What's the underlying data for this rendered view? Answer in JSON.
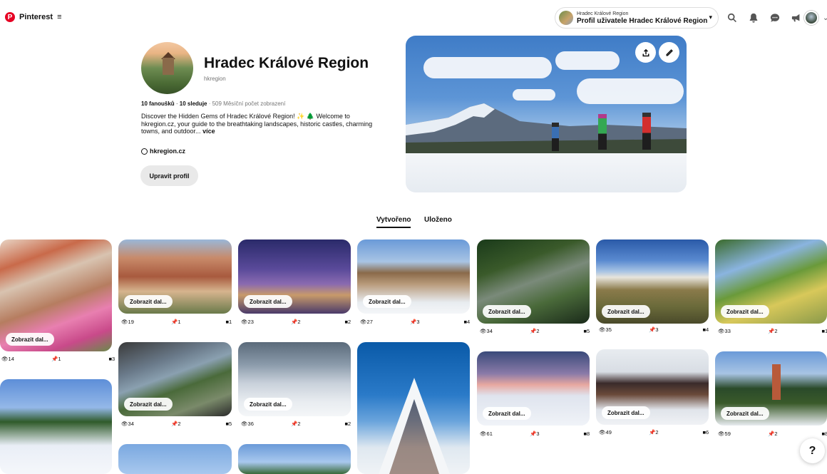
{
  "app": {
    "name": "Pinterest"
  },
  "header": {
    "switch_small": "Hradec Králové Region",
    "switch_main": "Profil uživatele Hradec Králové Region"
  },
  "profile": {
    "name": "Hradec Králové Region",
    "handle": "hkregion",
    "followers": "10 fanoušků",
    "following": "10 sleduje",
    "monthly_views": "509 Měsíční počet zobrazení",
    "bio": "Discover the Hidden Gems of Hradec Králové Region! ✨ 🌲 Welcome to hkregion.cz, your guide to the breathtaking landscapes, historic castles, charming towns, and outdoor...",
    "bio_more": "více",
    "website": "hkregion.cz",
    "edit_button": "Upravit profil"
  },
  "tabs": [
    {
      "label": "Vytvořeno",
      "active": true
    },
    {
      "label": "Uloženo",
      "active": false
    }
  ],
  "pin_button_label": "Zobrazit dal...",
  "pins": [
    {
      "views": "14",
      "pins": "1",
      "saves": "3"
    },
    {
      "views": "19",
      "pins": "1",
      "saves": "1"
    },
    {
      "views": "23",
      "pins": "2",
      "saves": "2"
    },
    {
      "views": "27",
      "pins": "3",
      "saves": "4"
    },
    {
      "views": "34",
      "pins": "2",
      "saves": "5"
    },
    {
      "views": "35",
      "pins": "3",
      "saves": "4"
    },
    {
      "views": "33",
      "pins": "2",
      "saves": "1"
    },
    {
      "views": "34",
      "pins": "2",
      "saves": "5"
    },
    {
      "views": "36",
      "pins": "2",
      "saves": "2"
    },
    {
      "views": "61",
      "pins": "3",
      "saves": "8"
    },
    {
      "views": "49",
      "pins": "2",
      "saves": "6"
    },
    {
      "views": "59",
      "pins": "2",
      "saves": "8"
    }
  ],
  "help_label": "?",
  "icons": [
    "pinterest-logo-icon",
    "menu-icon",
    "chevron-down-icon",
    "search-icon",
    "bell-icon",
    "chat-icon",
    "megaphone-icon",
    "upload-icon",
    "pencil-icon",
    "globe-icon",
    "eye-icon",
    "pin-icon",
    "save-icon",
    "help-icon"
  ]
}
